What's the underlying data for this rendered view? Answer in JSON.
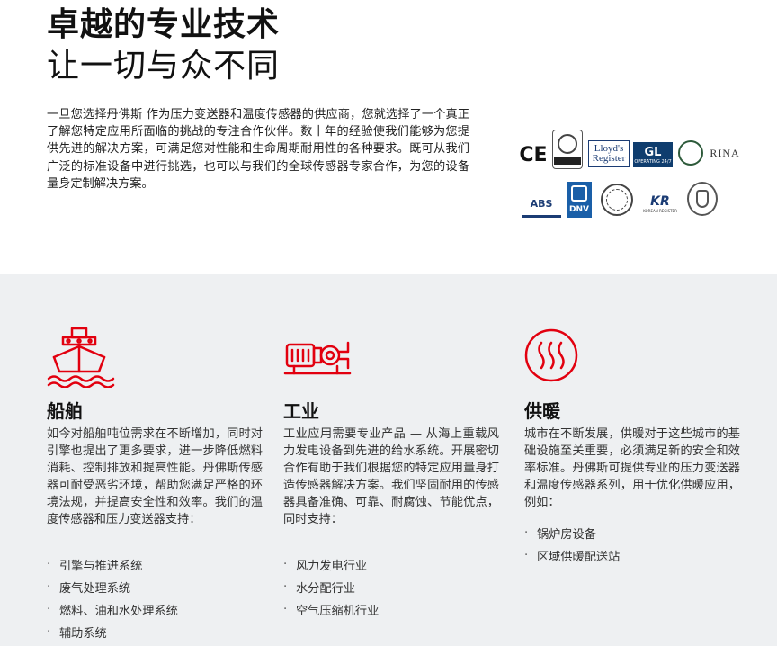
{
  "hero": {
    "title_bold": "卓越的专业技术",
    "title_light": "让一切与众不同",
    "intro": "一旦您选择丹佛斯 作为压力变送器和温度传感器的供应商，您就选择了一个真正了解您特定应用所面临的挑战的专注合作伙伴。数十年的经验使我们能够为您提供先进的解决方案，可满足您对性能和生命周期耐用性的各种要求。既可从我们广泛的标准设备中进行挑选，也可以与我们的全球传感器专家合作，为您的设备量身定制解决方案。"
  },
  "certifications": {
    "ce": "CE",
    "lloyds_line1": "Lloyd's",
    "lloyds_line2": "Register",
    "gl": "GL",
    "gl_sub": "OPERATING 24/7",
    "rina": "RINA",
    "abs": "ABS",
    "dnv": "DNV",
    "kr": "KR",
    "kr_sub": "KOREAN REGISTER"
  },
  "sections": [
    {
      "icon": "ship-icon",
      "title": "船舶",
      "text": "如今对船舶吨位需求在不断增加，同时对引擎也提出了更多要求，进一步降低燃料消耗、控制排放和提高性能。丹佛斯传感器可耐受恶劣环境，帮助您满足严格的环境法规，并提高安全性和效率。我们的温度传感器和压力变送器支持：",
      "bullets": [
        "引擎与推进系统",
        "废气处理系统",
        "燃料、油和水处理系统",
        "辅助系统"
      ]
    },
    {
      "icon": "industrial-motor-icon",
      "title": "工业",
      "text": "工业应用需要专业产品 — 从海上重载风力发电设备到先进的给水系统。开展密切合作有助于我们根据您的特定应用量身打造传感器解决方案。我们坚固耐用的传感器具备准确、可靠、耐腐蚀、节能优点，同时支持：",
      "bullets": [
        "风力发电行业",
        "水分配行业",
        "空气压缩机行业"
      ]
    },
    {
      "icon": "heating-icon",
      "title": "供暖",
      "text": "城市在不断发展，供暖对于这些城市的基础设施至关重要，必须满足新的安全和效率标准。丹佛斯可提供专业的压力变送器和温度传感器系列，用于优化供暖应用，例如：",
      "bullets": [
        "锅炉房设备",
        "区域供暖配送站"
      ]
    }
  ],
  "colors": {
    "accent_red": "#e2000f",
    "panel_bg": "#eef0f2"
  }
}
